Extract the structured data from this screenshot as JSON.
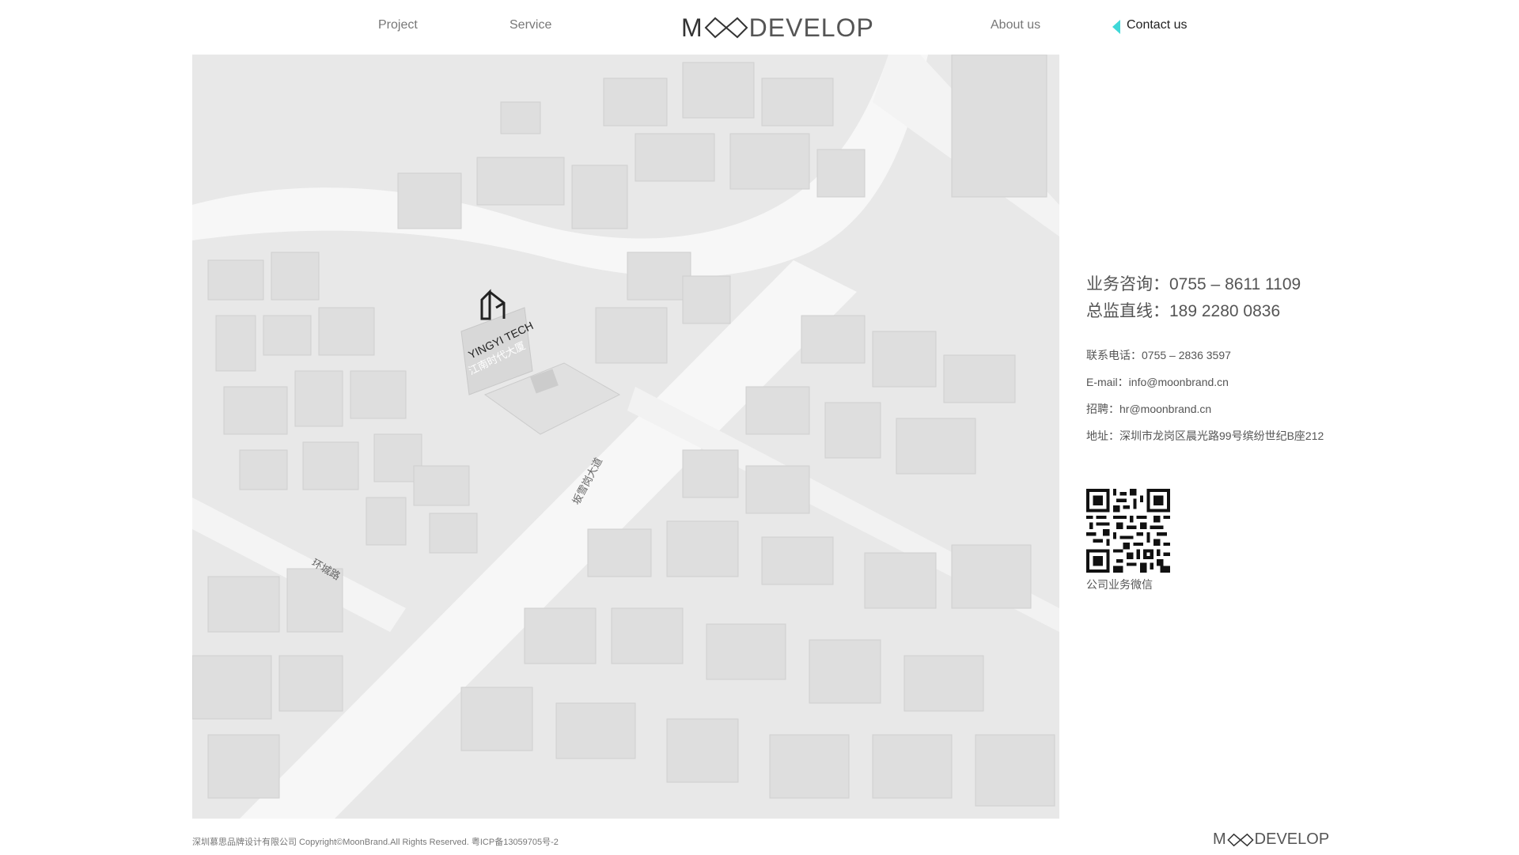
{
  "nav": {
    "items": [
      {
        "label": "Project"
      },
      {
        "label": "Service"
      },
      {
        "label": "About us"
      },
      {
        "label": "Contact us"
      }
    ],
    "active": "Contact us",
    "accent_color": "#3fd8d8"
  },
  "logo": {
    "first_letter": "M",
    "rest": "DEVELOP",
    "mark": "infinity-oo-icon"
  },
  "map": {
    "building_sign_en": "YINGYI TECH",
    "building_sign_cn": "江南时代大厦",
    "road_label_1": "坂雪岗大道",
    "road_label_2": "环城路"
  },
  "contact": {
    "hotline_1": "业务咨询：0755 – 8611 1109",
    "hotline_2": "总监直线：189 2280 0836",
    "phone": "联系电话：0755 – 2836 3597",
    "email": "E-mail：info@moonbrand.cn",
    "recruit": "招聘：hr@moonbrand.cn",
    "address": "地址：深圳市龙岗区晨光路99号缤纷世纪B座212",
    "qr_caption": "公司业务微信"
  },
  "footer": {
    "copyright": "深圳慕思品牌设计有限公司 Copyright©MoonBrand.All Rights Reserved.   粤ICP备13059705号-2",
    "logo_first": "M",
    "logo_rest": "DEVELOP"
  }
}
